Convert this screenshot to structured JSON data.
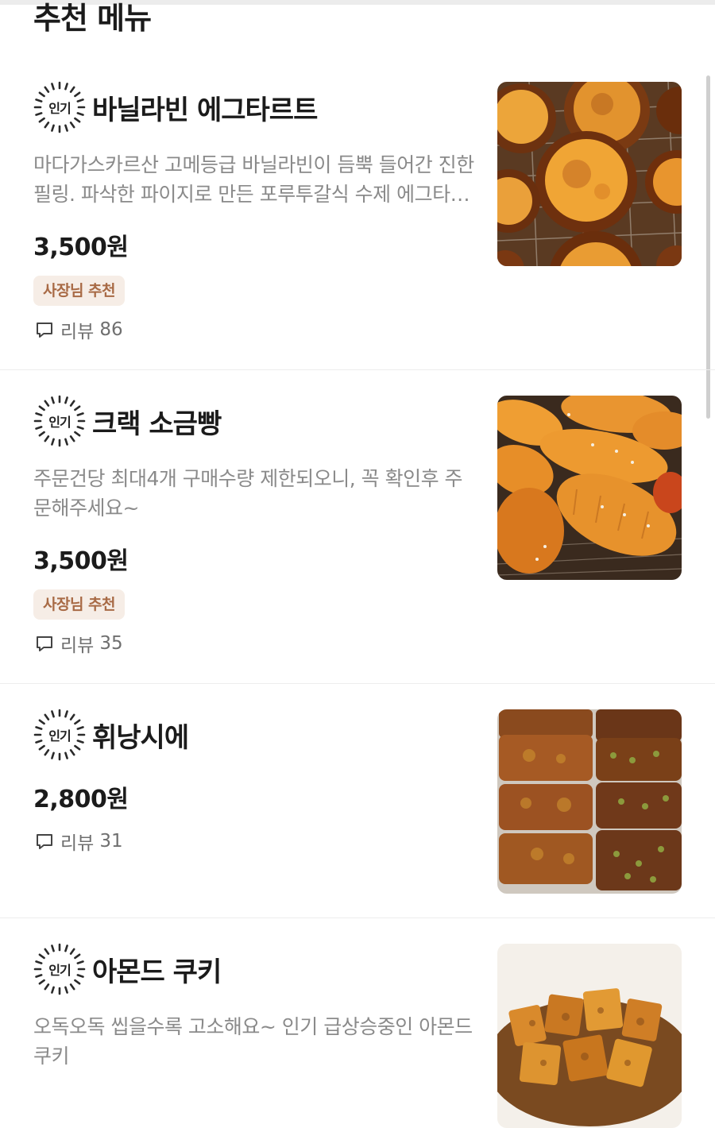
{
  "section": {
    "title": "추천 메뉴"
  },
  "badge_text": "인기",
  "review_label": "리뷰",
  "items": [
    {
      "name": "바닐라빈 에그타르트",
      "description": "마다가스카르산 고메등급 바닐라빈이 듬뿍 들어간 진한 필링. 파삭한 파이지로 만든 포루투갈식 수제 에그타르트",
      "price": "3,500원",
      "tag": "사장님 추천",
      "reviews": "86",
      "image": "egg-tart-photo"
    },
    {
      "name": "크랙 소금빵",
      "description": "주문건당 최대4개 구매수량 제한되오니, 꼭 확인후 주문해주세요~",
      "price": "3,500원",
      "tag": "사장님 추천",
      "reviews": "35",
      "image": "salt-bread-photo"
    },
    {
      "name": "휘낭시에",
      "price": "2,800원",
      "reviews": "31",
      "image": "financier-photo"
    },
    {
      "name": "아몬드 쿠키",
      "description": "오독오독 씹을수록 고소해요~ 인기 급상승중인 아몬드쿠키",
      "image": "almond-cookie-photo"
    }
  ],
  "colors": {
    "tag_background": "#f6ede6",
    "tag_text": "#a86a45",
    "muted_text": "#8a8a8a",
    "divider": "#ededed"
  }
}
